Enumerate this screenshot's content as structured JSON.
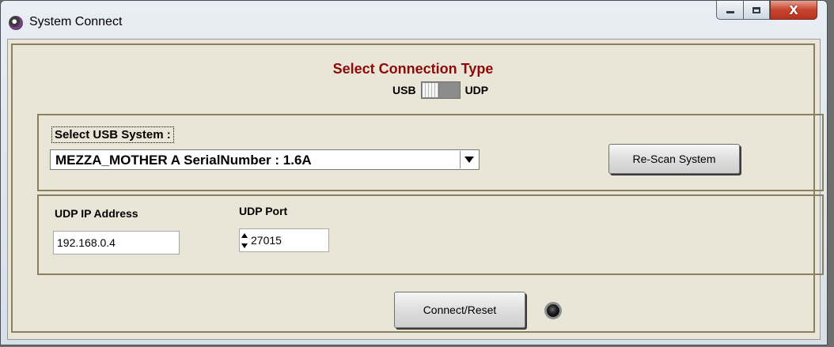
{
  "window": {
    "title": "System Connect",
    "controls": {
      "minimize": "minimize",
      "maximize": "maximize",
      "close": "X"
    }
  },
  "connection": {
    "heading": "Select Connection Type",
    "usb_label": "USB",
    "udp_label": "UDP",
    "selected": "USB"
  },
  "usb": {
    "select_label": "Select USB System :",
    "selected_system": "MEZZA_MOTHER A SerialNumber : 1.6A",
    "rescan_label": "Re-Scan System"
  },
  "udp": {
    "ip_label": "UDP IP Address",
    "ip_value": "192.168.0.4",
    "port_label": "UDP Port",
    "port_value": "27015"
  },
  "actions": {
    "connect_label": "Connect/Reset",
    "status_led": "off"
  },
  "colors": {
    "heading": "#8b0a0a",
    "panel_bg": "#eae6d7",
    "group_border": "#8b7f61",
    "close_button": "#c7442e"
  }
}
